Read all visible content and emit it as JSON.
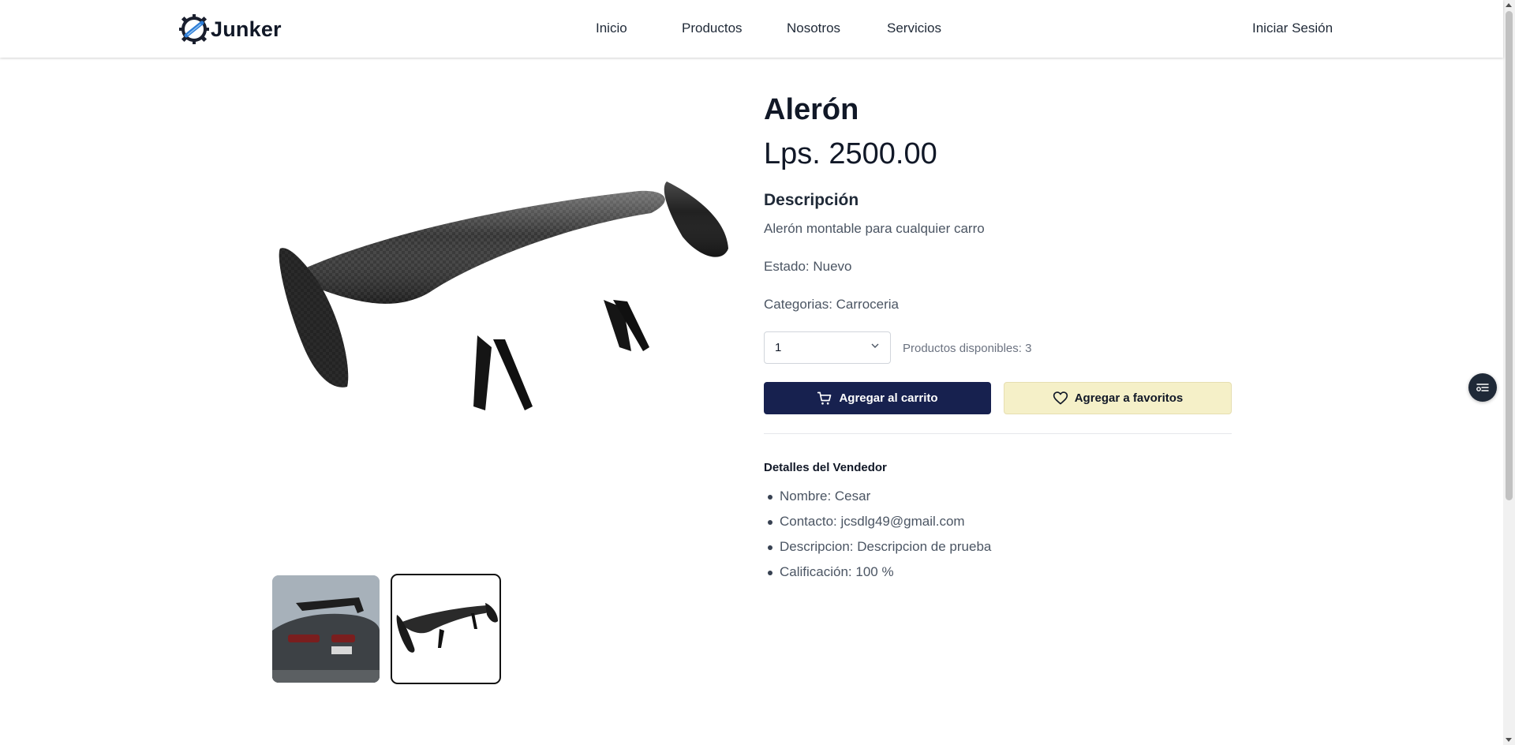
{
  "header": {
    "brand": "Junker",
    "nav": [
      "Inicio",
      "Productos",
      "Nosotros",
      "Servicios"
    ],
    "login_label": "Iniciar Sesión"
  },
  "product": {
    "title": "Alerón",
    "price": "Lps. 2500.00",
    "description_heading": "Descripción",
    "description": "Alerón montable para cualquier carro",
    "estado": "Estado: Nuevo",
    "categorias": "Categorias: Carroceria",
    "quantity_selected": "1",
    "available": "Productos disponibles: 3",
    "add_to_cart_label": "Agregar al carrito",
    "add_to_fav_label": "Agregar a favoritos"
  },
  "seller": {
    "heading": "Detalles del Vendedor",
    "items": [
      "Nombre: Cesar",
      "Contacto: jcsdlg49@gmail.com",
      "Descripcion: Descripcion de prueba",
      "Calificación: 100 %"
    ]
  },
  "colors": {
    "cart_button": "#17214f",
    "fav_button": "#f5f0c8",
    "logo_blue": "#2b7bd6"
  },
  "icons": [
    "junker-gear-logo-icon",
    "cart-icon",
    "heart-icon",
    "chevron-down-icon",
    "list-filter-icon"
  ]
}
